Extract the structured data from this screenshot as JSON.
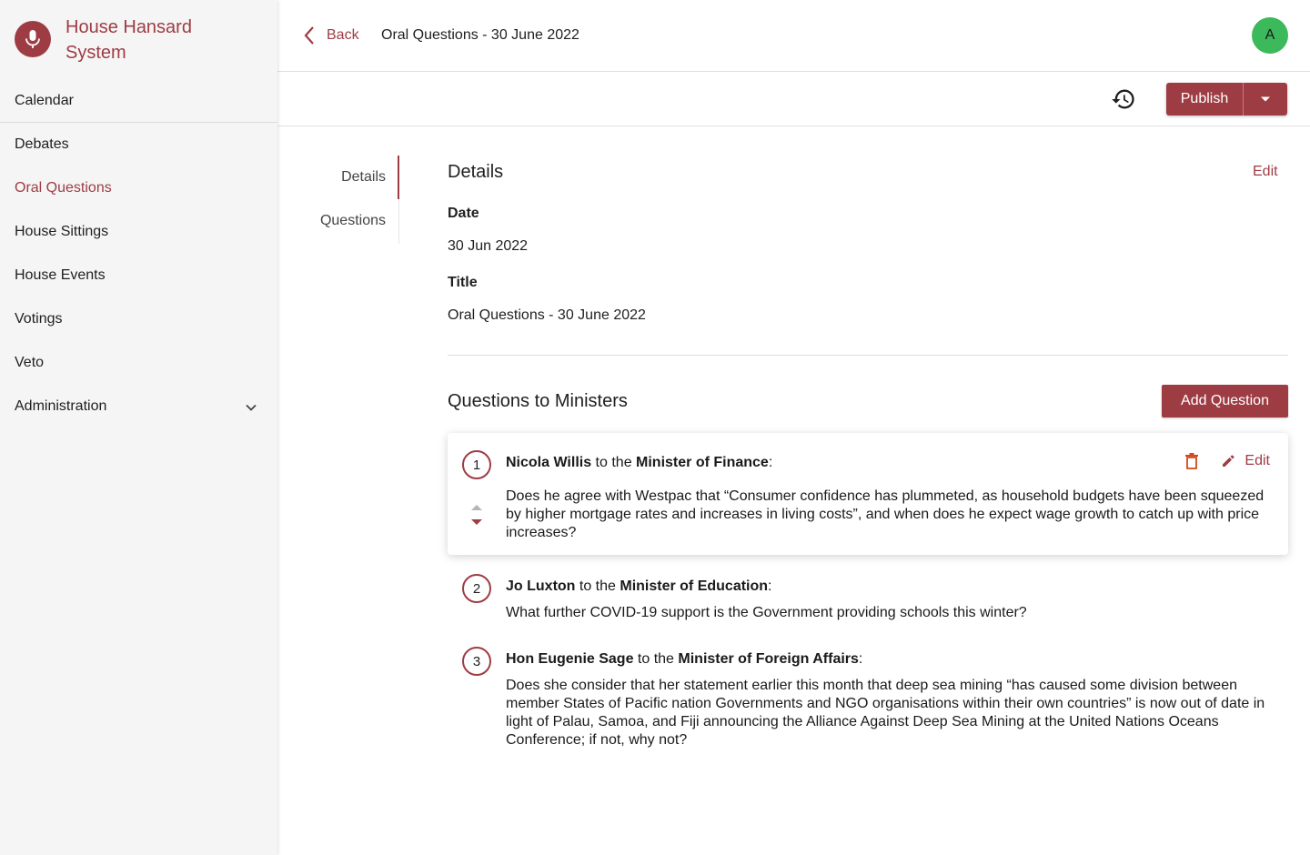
{
  "app": {
    "name": "House Hansard System"
  },
  "nav": {
    "items": [
      {
        "label": "Calendar"
      },
      {
        "label": "Debates"
      },
      {
        "label": "Oral Questions"
      },
      {
        "label": "House Sittings"
      },
      {
        "label": "House Events"
      },
      {
        "label": "Votings"
      },
      {
        "label": "Veto"
      },
      {
        "label": "Administration"
      }
    ],
    "active": "Oral Questions"
  },
  "header": {
    "back_label": "Back",
    "title": "Oral Questions - 30 June 2022",
    "avatar_initial": "A"
  },
  "toolbar": {
    "publish_label": "Publish"
  },
  "tabs": [
    {
      "label": "Details"
    },
    {
      "label": "Questions"
    }
  ],
  "details": {
    "heading": "Details",
    "edit_label": "Edit",
    "date_label": "Date",
    "date_value": "30 Jun 2022",
    "title_label": "Title",
    "title_value": "Oral Questions - 30 June 2022"
  },
  "questions_section": {
    "heading": "Questions to Ministers",
    "add_label": "Add Question",
    "connector": " to the ",
    "edit_label": "Edit",
    "items": [
      {
        "number": "1",
        "member": "Nicola Willis",
        "minister": "Minister of Finance",
        "text": "Does he agree with Westpac that “Consumer confidence has plummeted, as household budgets have been squeezed by higher mortgage rates and increases in living costs”, and when does he expect wage growth to catch up with price increases?"
      },
      {
        "number": "2",
        "member": "Jo Luxton",
        "minister": "Minister of Education",
        "text": "What further COVID-19 support is the Government providing schools this winter?"
      },
      {
        "number": "3",
        "member": "Hon Eugenie Sage",
        "minister": "Minister of Foreign Affairs",
        "text": "Does she consider that her statement earlier this month that deep sea mining “has caused some division between member States of Pacific nation Governments and NGO organisations within their own countries” is now out of date in light of Palau, Samoa, and Fiji announcing the Alliance Against Deep Sea Mining at the United Nations Oceans Conference; if not, why not?"
      }
    ]
  },
  "colors": {
    "accent": "#9e3c44",
    "avatar": "#3cb95a",
    "delete": "#c0392b"
  }
}
